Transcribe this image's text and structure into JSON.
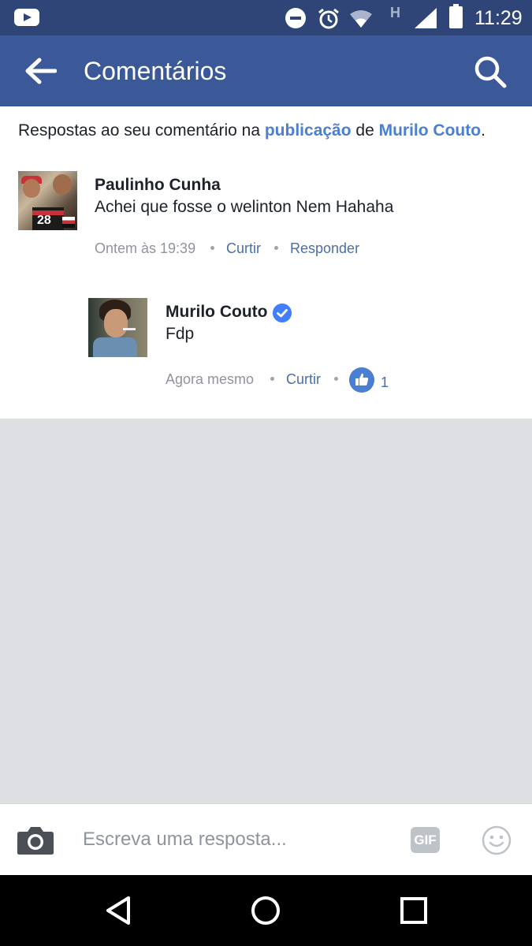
{
  "status_bar": {
    "time": "11:29",
    "network_label": "H",
    "icons": [
      "youtube-icon",
      "do-not-disturb-icon",
      "alarm-icon",
      "wifi-icon",
      "signal-icon",
      "battery-icon"
    ]
  },
  "header": {
    "title": "Comentários",
    "back_icon": "arrow-left-icon",
    "search_icon": "search-icon"
  },
  "notice": {
    "prefix": "Respostas ao seu comentário na ",
    "post_link": "publicação",
    "middle": " de ",
    "author_link": "Murilo Couto",
    "suffix": "."
  },
  "comments": [
    {
      "author": "Paulinho Cunha",
      "text": "Achei que fosse o welinton Nem Hahaha",
      "time": "Ontem às 19:39",
      "like_label": "Curtir",
      "reply_label": "Responder"
    },
    {
      "author": "Murilo Couto",
      "verified": true,
      "text": "Fdp",
      "time": "Agora mesmo",
      "like_label": "Curtir",
      "like_count": "1"
    }
  ],
  "reply_bar": {
    "placeholder": "Escreva uma resposta...",
    "gif_label": "GIF"
  },
  "colors": {
    "status_bar": "#2f4578",
    "header": "#3b5998",
    "link": "#4a7fd1",
    "action": "#4b6ea9",
    "background": "#dddfe2"
  }
}
